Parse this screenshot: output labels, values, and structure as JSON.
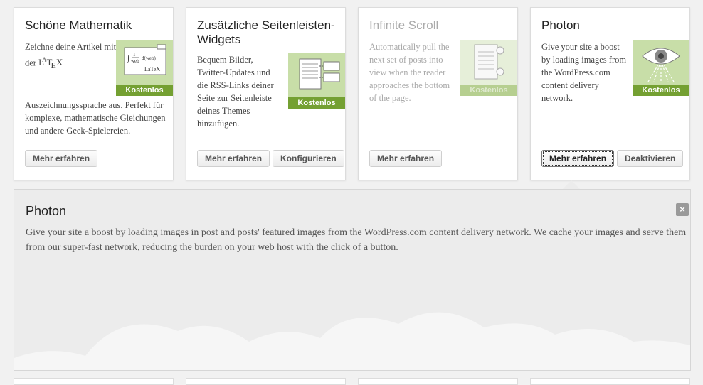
{
  "cards": [
    {
      "title": "Schöne Mathematik",
      "desc_top": "Zeichne deine Artikel mit der",
      "desc_logo": "LATEX",
      "desc_bottom": "Auszeichnungssprache aus. Perfekt für komplexe, mathematische Gleichungen und andere Geek-Spielereien.",
      "badge": "Kostenlos",
      "icon": "latex-formula-icon",
      "buttons": [
        "Mehr erfahren"
      ]
    },
    {
      "title": "Zusätzliche Seitenleisten-Widgets",
      "desc": "Bequem Bilder, Twitter-Updates und die RSS-Links deiner Seite zur Seitenleiste deines Themes hinzufügen.",
      "badge": "Kostenlos",
      "icon": "widgets-icon",
      "buttons": [
        "Mehr erfahren",
        "Konfigurieren"
      ]
    },
    {
      "title": "Infinite Scroll",
      "desc": "Automatically pull the next set of posts into view when the reader approaches the bottom of the page.",
      "badge": "Kostenlos",
      "icon": "scroll-icon",
      "buttons": [
        "Mehr erfahren"
      ]
    },
    {
      "title": "Photon",
      "desc": "Give your site a boost by loading images from the WordPress.com content delivery network.",
      "badge": "Kostenlos",
      "icon": "eye-icon",
      "buttons": [
        "Mehr erfahren",
        "Deaktivieren"
      ]
    }
  ],
  "detail": {
    "title": "Photon",
    "desc": "Give your site a boost by loading images in post and posts' featured images from the WordPress.com content delivery network. We cache your images and serve them from our super-fast network, reducing the burden on your web host with the click of a button.",
    "close": "×"
  },
  "colors": {
    "badge_green": "#74a032",
    "thumb_green": "#c8dea8",
    "panel_gray": "#ececec"
  }
}
